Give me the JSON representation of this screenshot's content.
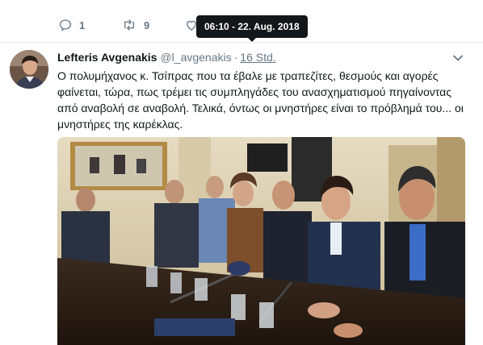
{
  "previous_tweet": {
    "reply_count": "1",
    "retweet_count": "9"
  },
  "tooltip": {
    "text": "06:10 - 22. Aug. 2018"
  },
  "tweet": {
    "fullname": "Lefteris Avgenakis",
    "username": "@l_avgenakis",
    "separator": "·",
    "time": "16 Std.",
    "text": "Ο πολυμήχανος κ. Τσίπρας που τα έβαλε με τραπεζίτες, θεσμούς και αγορές φαίνεται, τώρα, πως τρέμει τις συμπληγάδες του ανασχηματισμού πηγαίνοντας από αναβολή σε αναβολή. Τελικά, όντως οι μνηστήρες είναι το πρόβλημά του... οι μνηστήρες της καρέκλας."
  },
  "icons": {
    "reply": "reply-icon",
    "retweet": "retweet-icon",
    "like": "heart-icon",
    "more": "chevron-down-icon"
  },
  "colors": {
    "secondary_text": "#657786",
    "primary_text": "#14171a",
    "tooltip_bg": "#14171a",
    "divider": "#e6ecf0"
  }
}
